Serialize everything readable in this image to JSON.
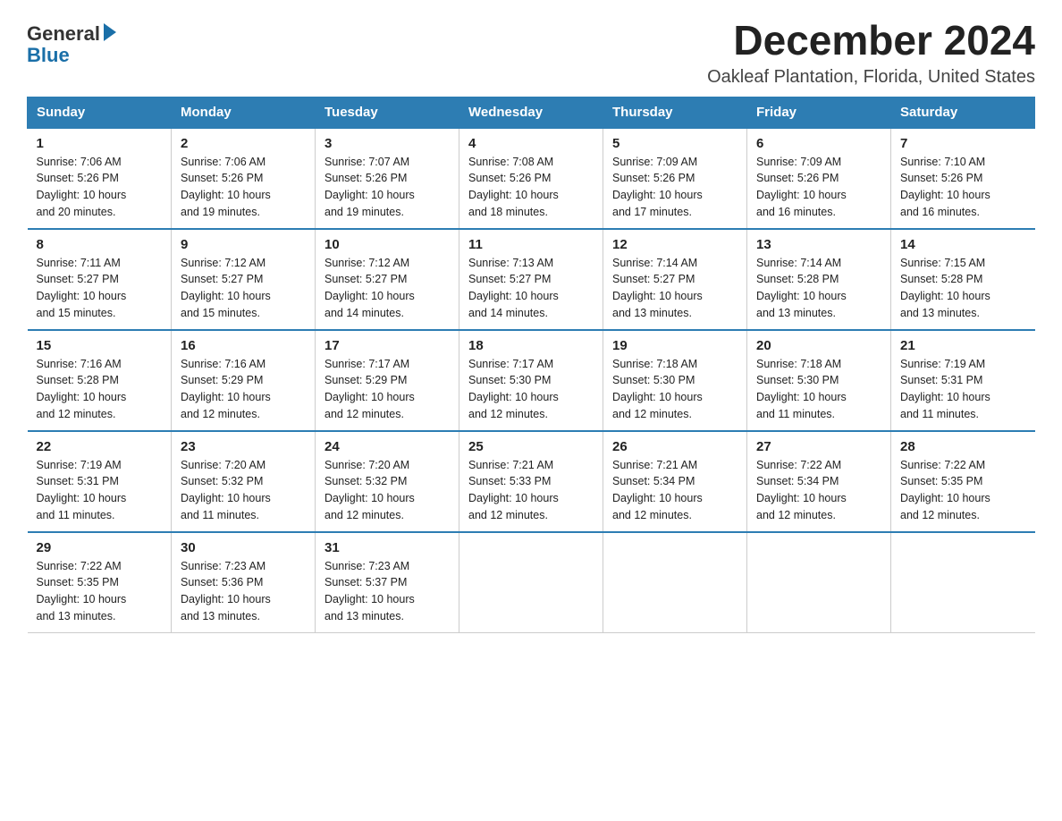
{
  "logo": {
    "general": "General",
    "blue": "Blue"
  },
  "title": "December 2024",
  "subtitle": "Oakleaf Plantation, Florida, United States",
  "days_of_week": [
    "Sunday",
    "Monday",
    "Tuesday",
    "Wednesday",
    "Thursday",
    "Friday",
    "Saturday"
  ],
  "weeks": [
    [
      {
        "day": "1",
        "sunrise": "7:06 AM",
        "sunset": "5:26 PM",
        "daylight": "10 hours and 20 minutes."
      },
      {
        "day": "2",
        "sunrise": "7:06 AM",
        "sunset": "5:26 PM",
        "daylight": "10 hours and 19 minutes."
      },
      {
        "day": "3",
        "sunrise": "7:07 AM",
        "sunset": "5:26 PM",
        "daylight": "10 hours and 19 minutes."
      },
      {
        "day": "4",
        "sunrise": "7:08 AM",
        "sunset": "5:26 PM",
        "daylight": "10 hours and 18 minutes."
      },
      {
        "day": "5",
        "sunrise": "7:09 AM",
        "sunset": "5:26 PM",
        "daylight": "10 hours and 17 minutes."
      },
      {
        "day": "6",
        "sunrise": "7:09 AM",
        "sunset": "5:26 PM",
        "daylight": "10 hours and 16 minutes."
      },
      {
        "day": "7",
        "sunrise": "7:10 AM",
        "sunset": "5:26 PM",
        "daylight": "10 hours and 16 minutes."
      }
    ],
    [
      {
        "day": "8",
        "sunrise": "7:11 AM",
        "sunset": "5:27 PM",
        "daylight": "10 hours and 15 minutes."
      },
      {
        "day": "9",
        "sunrise": "7:12 AM",
        "sunset": "5:27 PM",
        "daylight": "10 hours and 15 minutes."
      },
      {
        "day": "10",
        "sunrise": "7:12 AM",
        "sunset": "5:27 PM",
        "daylight": "10 hours and 14 minutes."
      },
      {
        "day": "11",
        "sunrise": "7:13 AM",
        "sunset": "5:27 PM",
        "daylight": "10 hours and 14 minutes."
      },
      {
        "day": "12",
        "sunrise": "7:14 AM",
        "sunset": "5:27 PM",
        "daylight": "10 hours and 13 minutes."
      },
      {
        "day": "13",
        "sunrise": "7:14 AM",
        "sunset": "5:28 PM",
        "daylight": "10 hours and 13 minutes."
      },
      {
        "day": "14",
        "sunrise": "7:15 AM",
        "sunset": "5:28 PM",
        "daylight": "10 hours and 13 minutes."
      }
    ],
    [
      {
        "day": "15",
        "sunrise": "7:16 AM",
        "sunset": "5:28 PM",
        "daylight": "10 hours and 12 minutes."
      },
      {
        "day": "16",
        "sunrise": "7:16 AM",
        "sunset": "5:29 PM",
        "daylight": "10 hours and 12 minutes."
      },
      {
        "day": "17",
        "sunrise": "7:17 AM",
        "sunset": "5:29 PM",
        "daylight": "10 hours and 12 minutes."
      },
      {
        "day": "18",
        "sunrise": "7:17 AM",
        "sunset": "5:30 PM",
        "daylight": "10 hours and 12 minutes."
      },
      {
        "day": "19",
        "sunrise": "7:18 AM",
        "sunset": "5:30 PM",
        "daylight": "10 hours and 12 minutes."
      },
      {
        "day": "20",
        "sunrise": "7:18 AM",
        "sunset": "5:30 PM",
        "daylight": "10 hours and 11 minutes."
      },
      {
        "day": "21",
        "sunrise": "7:19 AM",
        "sunset": "5:31 PM",
        "daylight": "10 hours and 11 minutes."
      }
    ],
    [
      {
        "day": "22",
        "sunrise": "7:19 AM",
        "sunset": "5:31 PM",
        "daylight": "10 hours and 11 minutes."
      },
      {
        "day": "23",
        "sunrise": "7:20 AM",
        "sunset": "5:32 PM",
        "daylight": "10 hours and 11 minutes."
      },
      {
        "day": "24",
        "sunrise": "7:20 AM",
        "sunset": "5:32 PM",
        "daylight": "10 hours and 12 minutes."
      },
      {
        "day": "25",
        "sunrise": "7:21 AM",
        "sunset": "5:33 PM",
        "daylight": "10 hours and 12 minutes."
      },
      {
        "day": "26",
        "sunrise": "7:21 AM",
        "sunset": "5:34 PM",
        "daylight": "10 hours and 12 minutes."
      },
      {
        "day": "27",
        "sunrise": "7:22 AM",
        "sunset": "5:34 PM",
        "daylight": "10 hours and 12 minutes."
      },
      {
        "day": "28",
        "sunrise": "7:22 AM",
        "sunset": "5:35 PM",
        "daylight": "10 hours and 12 minutes."
      }
    ],
    [
      {
        "day": "29",
        "sunrise": "7:22 AM",
        "sunset": "5:35 PM",
        "daylight": "10 hours and 13 minutes."
      },
      {
        "day": "30",
        "sunrise": "7:23 AM",
        "sunset": "5:36 PM",
        "daylight": "10 hours and 13 minutes."
      },
      {
        "day": "31",
        "sunrise": "7:23 AM",
        "sunset": "5:37 PM",
        "daylight": "10 hours and 13 minutes."
      },
      null,
      null,
      null,
      null
    ]
  ],
  "labels": {
    "sunrise": "Sunrise:",
    "sunset": "Sunset:",
    "daylight": "Daylight:"
  }
}
